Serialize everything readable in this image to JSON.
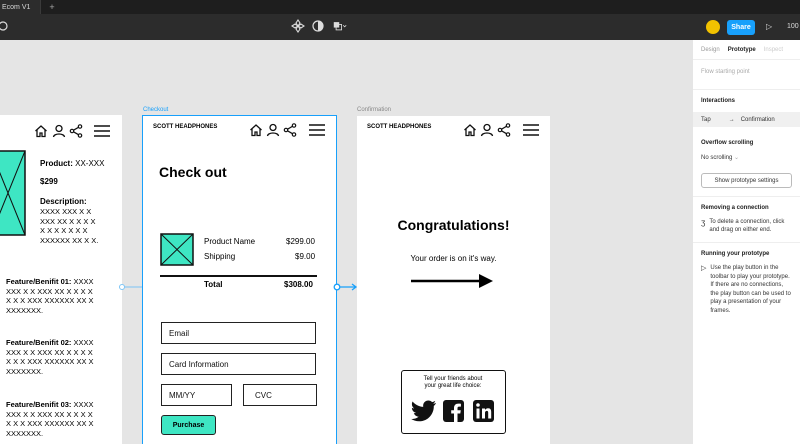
{
  "titlebar": {
    "tab_label": "Ecom V1",
    "new_tab": "+"
  },
  "toolbar": {
    "avatar_initial": "",
    "share_label": "Share",
    "play_icon": "play-icon",
    "zoom": "100"
  },
  "frames": {
    "product": {
      "nav_title": "",
      "product_label": "Product:",
      "product_value": "XX-XXX",
      "price": "$299",
      "description_label": "Description:",
      "description_lines": [
        "XXXX XXX X X",
        "XXX XX X X X X",
        "X X X X X X X",
        "XXXXXX XX X X."
      ],
      "features": [
        {
          "title": "Feature/Benifit 01:",
          "first": "XXXX",
          "lines": [
            "XXX X X XXX XX X X X X",
            "X X X XXX XXXXXX XX X",
            "XXXXXXX."
          ]
        },
        {
          "title": "Feature/Benifit 02:",
          "first": "XXXX",
          "lines": [
            "XXX X X XXX XX X X X X",
            "X X X XXX XXXXXX XX X",
            "XXXXXXX."
          ]
        },
        {
          "title": "Feature/Benifit 03:",
          "first": "XXXX",
          "lines": [
            "XXX X X XXX XX X X X X",
            "X X X XXX XXXXXX XX X",
            "XXXXXXX."
          ]
        }
      ],
      "image_caption": "t"
    },
    "checkout": {
      "label": "Checkout",
      "brand": "SCOTT HEADPHONES",
      "title": "Check out",
      "product_name": "Product Name",
      "product_price": "$299.00",
      "shipping": "Shipping",
      "shipping_price": "$9.00",
      "total": "Total",
      "total_price": "$308.00",
      "email": "Email",
      "card": "Card Information",
      "mmyy": "MM/YY",
      "cvc": "CVC",
      "purchase": "Purchase"
    },
    "confirmation": {
      "label": "Confirmation",
      "brand": "SCOTT HEADPHONES",
      "title": "Congratulations!",
      "subtitle": "Your order is on it's way.",
      "share_line1": "Tell your friends about",
      "share_line2": "your great life choice:"
    }
  },
  "panel": {
    "tabs": [
      "Design",
      "Prototype",
      "Inspect"
    ],
    "active_tab": "Prototype",
    "flow_starting_point": "Flow starting point",
    "interactions_title": "Interactions",
    "interaction_trigger": "Tap",
    "interaction_target": "Confirmation",
    "overflow_title": "Overflow scrolling",
    "overflow_value": "No scrolling",
    "settings_button": "Show prototype settings",
    "removing_title": "Removing a connection",
    "removing_text": "To delete a connection, click and drag on either end.",
    "running_title": "Running your prototype",
    "running_text": "Use the play button in the toolbar to play your prototype. If there are no connections, the play button can be used to play a presentation of your frames."
  },
  "colors": {
    "accent": "#18a0fb",
    "teal": "#3ee6c3",
    "toolbar": "#2c2c2c"
  }
}
